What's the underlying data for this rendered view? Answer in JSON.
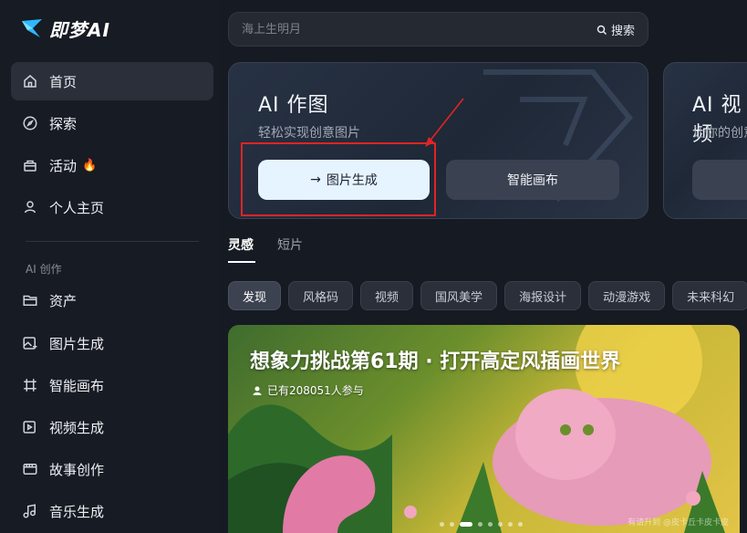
{
  "app": {
    "logo_text": "即梦AI"
  },
  "sidebar": {
    "items": [
      {
        "label": "首页"
      },
      {
        "label": "探索"
      },
      {
        "label": "活动",
        "badge": "🔥"
      },
      {
        "label": "个人主页"
      }
    ],
    "section_title": "AI 创作",
    "creation_items": [
      {
        "label": "资产"
      },
      {
        "label": "图片生成"
      },
      {
        "label": "智能画布"
      },
      {
        "label": "视频生成"
      },
      {
        "label": "故事创作"
      },
      {
        "label": "音乐生成"
      }
    ]
  },
  "search": {
    "placeholder": "海上生明月",
    "button_label": "搜索"
  },
  "cards": [
    {
      "title": "AI 作图",
      "subtitle": "轻松实现创意图片",
      "primary_button": "图片生成",
      "secondary_button": "智能画布"
    },
    {
      "title": "AI 视频",
      "subtitle": "让你的创意"
    }
  ],
  "tabs": [
    {
      "label": "灵感"
    },
    {
      "label": "短片"
    }
  ],
  "chips": [
    "发现",
    "风格码",
    "视频",
    "国风美学",
    "海报设计",
    "动漫游戏",
    "未来科幻"
  ],
  "banner": {
    "title": "想象力挑战第61期 · 打开高定风插画世界",
    "participants": "已有208051人参与",
    "watermark": "有请升到 @皮卡丘卡皮卡皮"
  },
  "colors": {
    "accent_light": "#e6f4ff",
    "highlight_red": "#e02424",
    "bg": "#161a22"
  }
}
